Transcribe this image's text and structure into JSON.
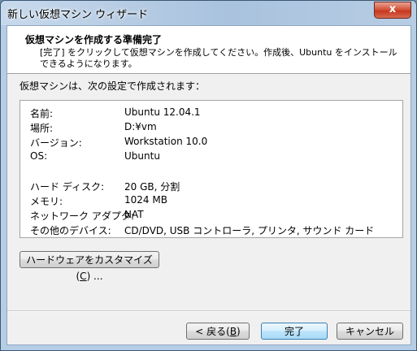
{
  "window": {
    "title": "新しい仮想マシン ウィザード",
    "close_label": "x"
  },
  "header": {
    "title": "仮想マシンを作成する準備完了",
    "description": "[完了] をクリックして仮想マシンを作成してください。作成後、Ubuntu をインストールできるようになります。"
  },
  "intro": "仮想マシンは、次の設定で作成されます：",
  "summary": {
    "name": {
      "label": "名前:",
      "value": "Ubuntu 12.04.1"
    },
    "location": {
      "label": "場所:",
      "value": "D:¥vm"
    },
    "version": {
      "label": "バージョン:",
      "value": "Workstation 10.0"
    },
    "os": {
      "label": "OS:",
      "value": "Ubuntu"
    },
    "disk": {
      "label": "ハード ディスク:",
      "value": "20 GB, 分割"
    },
    "memory": {
      "label": "メモリ:",
      "value": "1024 MB"
    },
    "network": {
      "label": "ネットワーク アダプタ:",
      "value": "NAT"
    },
    "devices": {
      "label": "その他のデバイス:",
      "value": "CD/DVD, USB コントローラ, プリンタ, サウンド カード"
    }
  },
  "buttons": {
    "customize_text": "ハードウェアをカスタマイズ(",
    "customize_key": "C",
    "customize_suffix": ") ...",
    "back_text": "< 戻る(",
    "back_key": "B",
    "back_suffix": ")",
    "finish": "完了",
    "cancel": "キャンセル"
  }
}
